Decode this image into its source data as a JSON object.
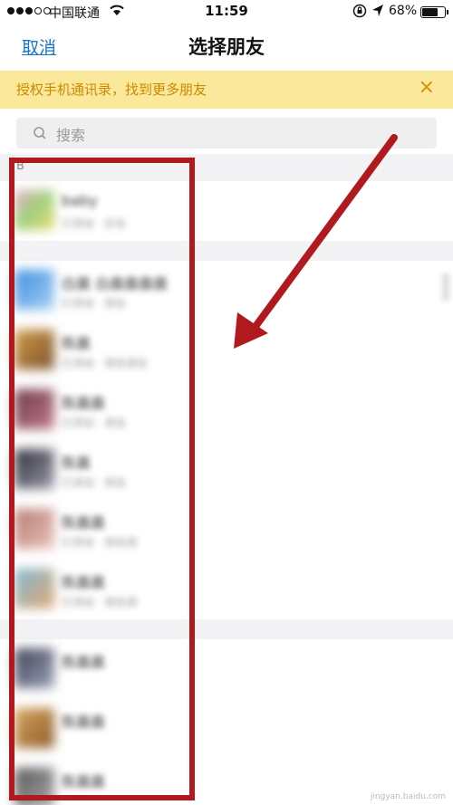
{
  "status_bar": {
    "carrier": "中国联通",
    "time": "11:59",
    "battery": "68%"
  },
  "nav": {
    "cancel_label": "取消",
    "title": "选择朋友"
  },
  "banner": {
    "text": "授权手机通讯录，找到更多朋友",
    "close_label": "×"
  },
  "search": {
    "placeholder": "搜索"
  },
  "contacts": {
    "section_letter": "B",
    "items": [
      {
        "name": "baby",
        "sub": "已添加 · 好友"
      },
      {
        "name": "白晨 白晨晨晨晨",
        "sub": "已添加 · 朋友"
      },
      {
        "name": "陈晨",
        "sub": "已添加 · 朋友朋友"
      },
      {
        "name": "陈晨晨",
        "sub": "已添加 · 朋友"
      },
      {
        "name": "陈晨",
        "sub": "已添加 · 朋友"
      },
      {
        "name": "陈晨晨",
        "sub": "已添加 · 朋友朋"
      },
      {
        "name": "陈晨晨",
        "sub": "已添加 · 朋友朋"
      },
      {
        "name": "陈晨晨",
        "sub": ""
      },
      {
        "name": "陈晨晨",
        "sub": ""
      },
      {
        "name": "陈晨晨",
        "sub": ""
      }
    ]
  },
  "watermark": "jingyan.baidu.com",
  "colors": {
    "accent": "#1a74c7",
    "banner_bg": "#fbe89a",
    "banner_text": "#c98a00",
    "annotation": "#b0191d"
  }
}
